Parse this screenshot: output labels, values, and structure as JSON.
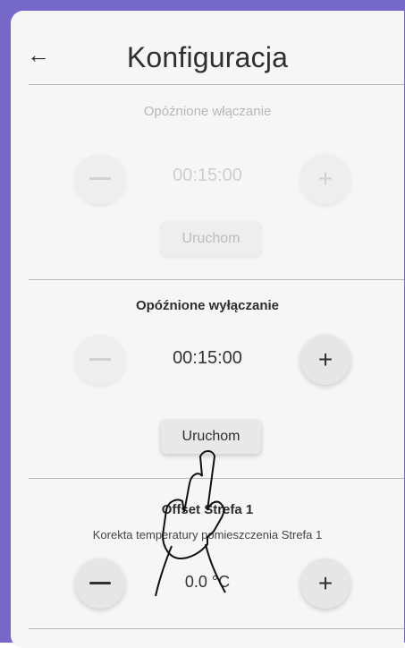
{
  "header": {
    "title": "Konfiguracja",
    "back_icon": "←"
  },
  "delayed_on": {
    "title": "Opóźnione włączanie",
    "time": "00:15:00",
    "minus_icon": "minus-icon",
    "plus_label": "+",
    "start_label": "Uruchom",
    "state": "disabled"
  },
  "delayed_off": {
    "title": "Opóźnione wyłączanie",
    "time": "00:15:00",
    "plus_label": "+",
    "start_label": "Uruchom",
    "state": "enabled"
  },
  "offset": {
    "title": "Offset Strefa 1",
    "subtitle": "Korekta temperatury pomieszczenia Strefa 1",
    "value": "0.0 °C",
    "plus_label": "+"
  },
  "colors": {
    "accent": "#7568c9",
    "background": "#f6f6f6"
  }
}
